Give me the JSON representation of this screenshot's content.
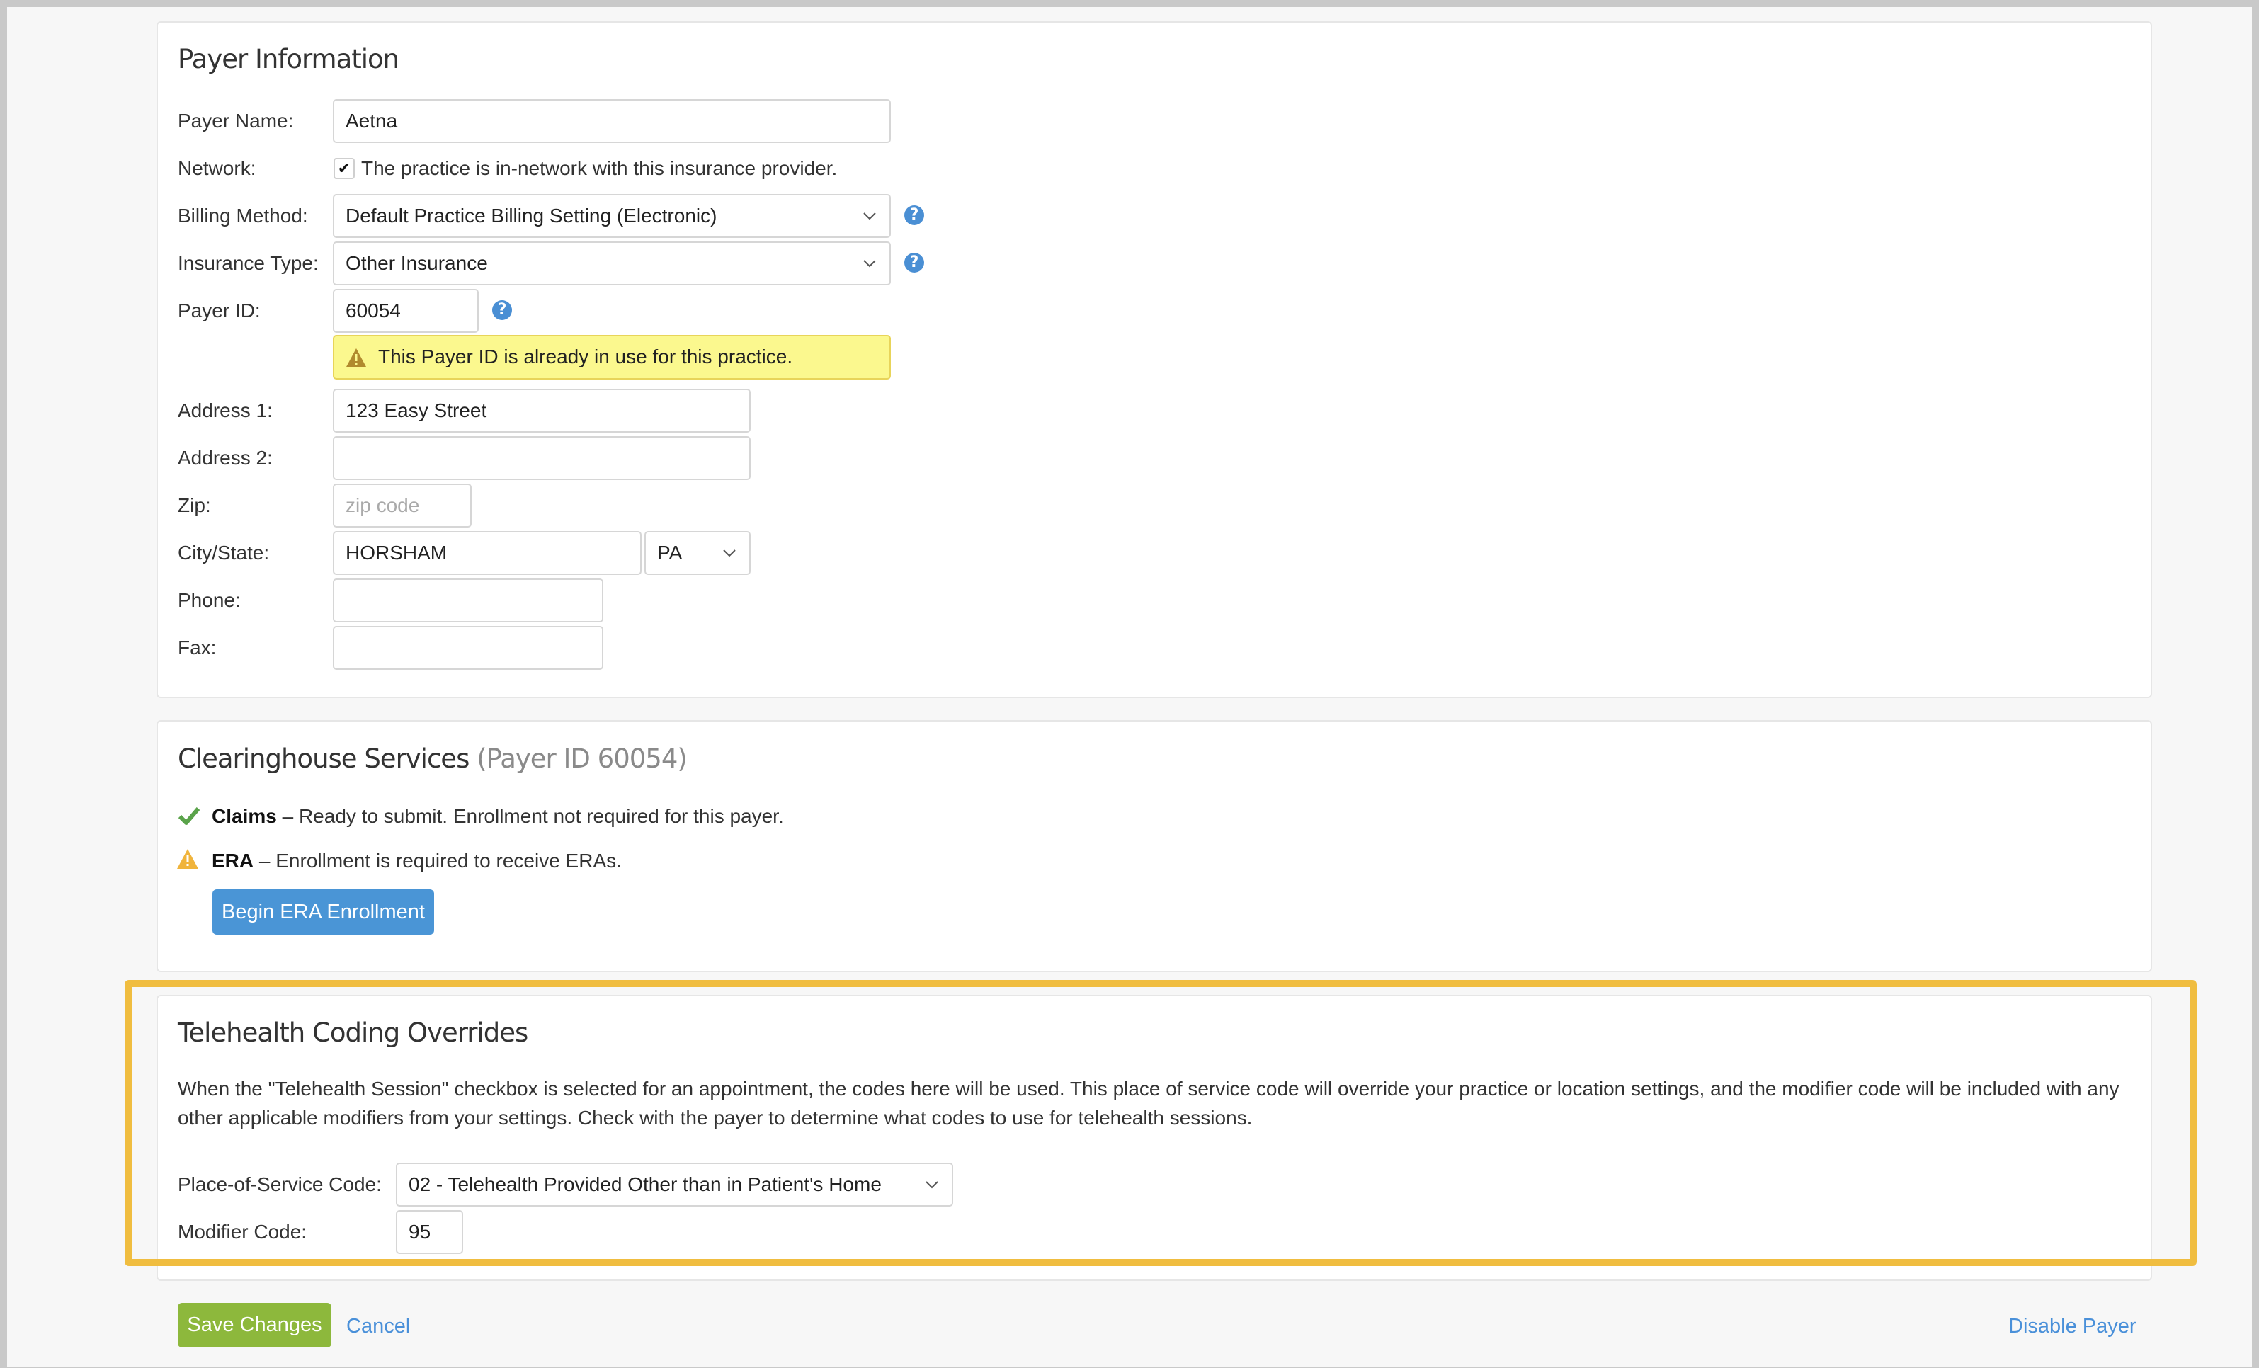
{
  "payer_info": {
    "heading": "Payer Information",
    "payer_name": {
      "label": "Payer Name:",
      "value": "Aetna"
    },
    "network": {
      "label": "Network:",
      "checked": true,
      "checkbox_label": "The practice is in-network with this insurance provider."
    },
    "billing_method": {
      "label": "Billing Method:",
      "value": "Default Practice Billing Setting (Electronic)"
    },
    "insurance_type": {
      "label": "Insurance Type:",
      "value": "Other Insurance"
    },
    "payer_id": {
      "label": "Payer ID:",
      "value": "60054"
    },
    "payer_id_warning": "This Payer ID is already in use for this practice.",
    "address1": {
      "label": "Address 1:",
      "value": "123 Easy Street"
    },
    "address2": {
      "label": "Address 2:",
      "value": ""
    },
    "zip": {
      "label": "Zip:",
      "value": "",
      "placeholder": "zip code"
    },
    "city_state": {
      "label": "City/State:",
      "city": "HORSHAM",
      "state": "PA"
    },
    "phone": {
      "label": "Phone:",
      "value": ""
    },
    "fax": {
      "label": "Fax:",
      "value": ""
    }
  },
  "clearinghouse": {
    "heading": "Clearinghouse Services",
    "heading_suffix": "(Payer ID 60054)",
    "claims": {
      "name": "Claims",
      "text": " – Ready to submit. Enrollment not required for this payer.",
      "status": "ok"
    },
    "era": {
      "name": "ERA",
      "text": " – Enrollment is required to receive ERAs.",
      "status": "warning"
    },
    "enroll_button": "Begin ERA Enrollment"
  },
  "telehealth": {
    "heading": "Telehealth Coding Overrides",
    "description": "When the \"Telehealth Session\" checkbox is selected for an appointment, the codes here will be used. This place of service code will override your practice or location settings, and the modifier code will be included with any other applicable modifiers from your settings. Check with the payer to determine what codes to use for telehealth sessions.",
    "pos_code": {
      "label": "Place-of-Service Code:",
      "value": "02 - Telehealth Provided Other than in Patient's Home"
    },
    "modifier_code": {
      "label": "Modifier Code:",
      "value": "95"
    }
  },
  "footer": {
    "save": "Save Changes",
    "cancel": "Cancel",
    "disable": "Disable Payer"
  },
  "colors": {
    "accent_blue": "#4a90d9",
    "save_green": "#8db83c",
    "highlight": "#f0bd40",
    "warning_bg": "#fbf88e"
  }
}
